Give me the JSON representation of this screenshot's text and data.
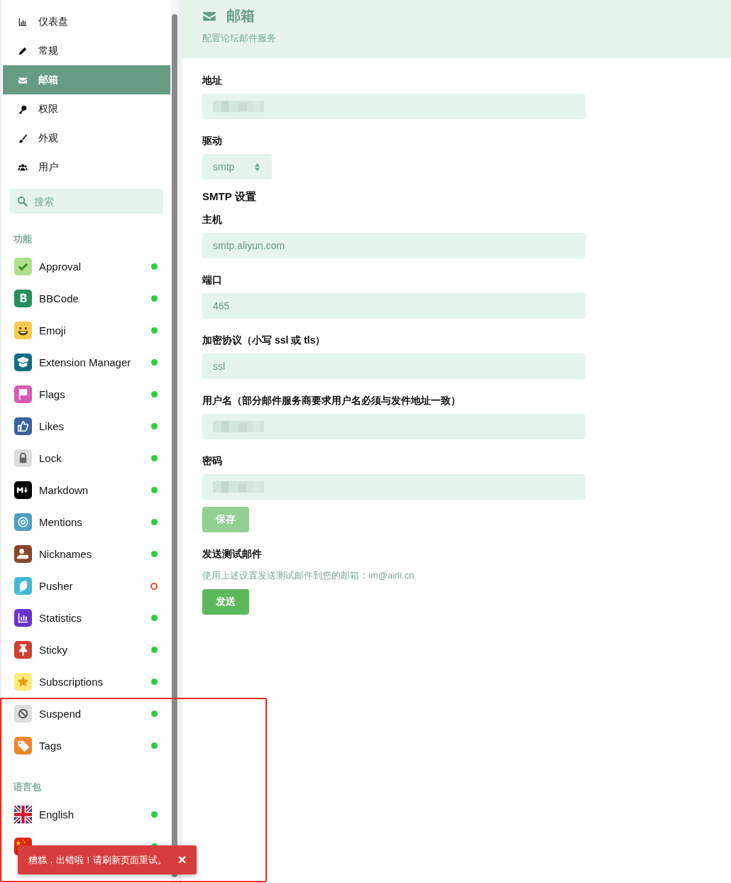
{
  "sidebar": {
    "nav": [
      {
        "label": "仪表盘",
        "kind": "chart",
        "selected": false
      },
      {
        "label": "常规",
        "kind": "pencil",
        "selected": false
      },
      {
        "label": "邮箱",
        "kind": "envelope",
        "selected": true
      },
      {
        "label": "权限",
        "kind": "key",
        "selected": false
      },
      {
        "label": "外观",
        "kind": "brush",
        "selected": false
      },
      {
        "label": "用户",
        "kind": "users",
        "selected": false
      }
    ],
    "search": {
      "placeholder": "搜索"
    },
    "sections": [
      {
        "title": "功能",
        "items": [
          {
            "name": "Approval",
            "kind": "check",
            "color": "#b0df8a",
            "enabled": true
          },
          {
            "name": "BBCode",
            "kind": "letter",
            "color": "#258f5c",
            "enabled": true
          },
          {
            "name": "Emoji",
            "kind": "smile",
            "color": "#fdc94e",
            "enabled": true
          },
          {
            "name": "Extension Manager",
            "kind": "box",
            "color": "#116c85",
            "enabled": true
          },
          {
            "name": "Flags",
            "kind": "flag",
            "color": "#d95ab7",
            "enabled": true
          },
          {
            "name": "Likes",
            "kind": "thumb",
            "color": "#3a629f",
            "enabled": true
          },
          {
            "name": "Lock",
            "kind": "lock",
            "color": "#dddddd",
            "enabled": true
          },
          {
            "name": "Markdown",
            "kind": "markdown",
            "color": "#000000",
            "enabled": true
          },
          {
            "name": "Mentions",
            "kind": "at",
            "color": "#539fc1",
            "enabled": true
          },
          {
            "name": "Nicknames",
            "kind": "person",
            "color": "#87462a",
            "enabled": true
          },
          {
            "name": "Pusher",
            "kind": "feather",
            "color": "#40bad8",
            "enabled": false
          },
          {
            "name": "Statistics",
            "kind": "bars",
            "color": "#6932d0",
            "enabled": true
          },
          {
            "name": "Sticky",
            "kind": "pin",
            "color": "#d13e32",
            "enabled": true
          },
          {
            "name": "Subscriptions",
            "kind": "star",
            "color": "#ffea7b",
            "enabled": true
          },
          {
            "name": "Suspend",
            "kind": "ban",
            "color": "#dddddd",
            "enabled": true
          },
          {
            "name": "Tags",
            "kind": "tag",
            "color": "#f28326",
            "enabled": true
          }
        ]
      },
      {
        "title": "语言包",
        "items": [
          {
            "name": "English",
            "kind": "flag-uk",
            "enabled": true
          },
          {
            "kind": "flag-cn",
            "enabled": true
          }
        ]
      }
    ]
  },
  "header": {
    "title": "邮箱",
    "subtitle": "配置论坛邮件服务"
  },
  "form": [
    {
      "kind": "field",
      "label": "地址",
      "redacted": true
    },
    {
      "kind": "select",
      "label": "驱动",
      "value": "smtp"
    },
    {
      "kind": "heading",
      "label": "SMTP 设置"
    },
    {
      "kind": "field",
      "label": "主机",
      "value": "smtp.aliyun.com"
    },
    {
      "kind": "field",
      "label": "端口",
      "value": "465"
    },
    {
      "kind": "field",
      "label": "加密协议（小写 ssl 或 tls）",
      "value": "ssl"
    },
    {
      "kind": "field",
      "label": "用户名（部分邮件服务商要求用户名必须与发件地址一致）",
      "redacted": true
    },
    {
      "kind": "field",
      "label": "密码",
      "redacted": true
    }
  ],
  "save_button": {
    "label": "保存",
    "disabled": true
  },
  "test_mail": {
    "title": "发送测试邮件",
    "text": "使用上述设置发送测试邮件到您的邮箱：im@airli.cn",
    "button": "发送"
  },
  "toast": {
    "message": "糟糕，出错啦！请刷新页面重试。",
    "close": "✕"
  }
}
